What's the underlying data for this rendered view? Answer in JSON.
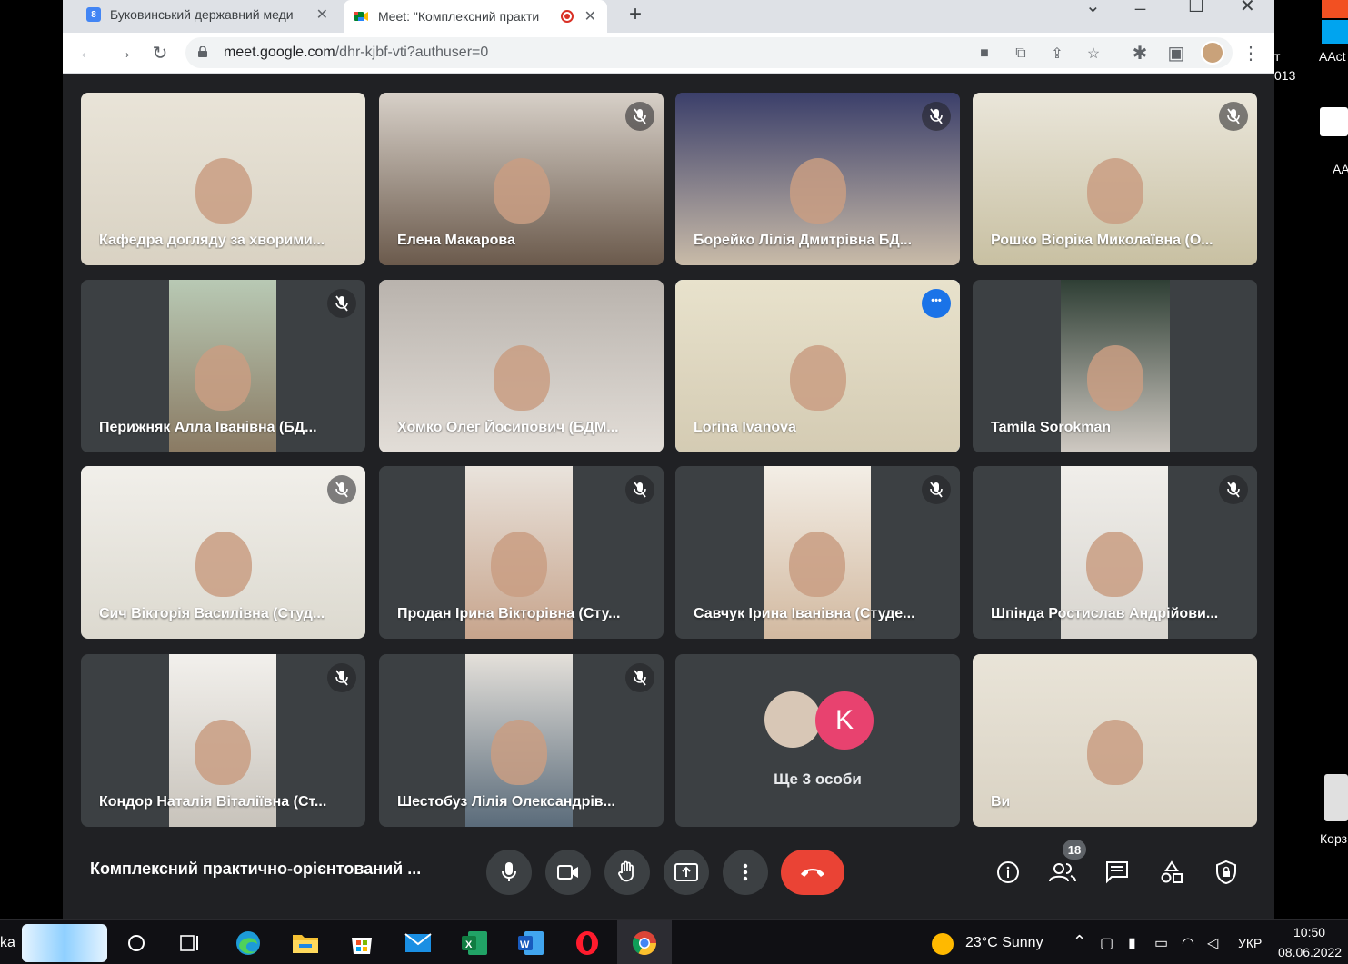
{
  "browser": {
    "tabs": [
      {
        "title": "Буковинський державний меди",
        "favicon": "calendar-icon"
      },
      {
        "title": "Meet: \"Комплексний практи",
        "favicon": "meet-icon",
        "recording": true
      }
    ],
    "url_host": "meet.google.com",
    "url_path": "/dhr-kjbf-vti?authuser=0"
  },
  "participants": [
    {
      "name": "Кафедра догляду за хворими...",
      "muted": false
    },
    {
      "name": "Елена Макарова",
      "muted": true
    },
    {
      "name": "Борейко Лілія Дмитрівна БД...",
      "muted": true
    },
    {
      "name": "Рошко Віоріка Миколаївна (О...",
      "muted": true
    },
    {
      "name": "Перижняк Алла Іванівна (БД...",
      "muted": true
    },
    {
      "name": "Хомко Олег Йосипович (БДМ...",
      "muted": false
    },
    {
      "name": "Lorina Ivanova",
      "muted": false,
      "speaking": true
    },
    {
      "name": "Tamila Sorokman",
      "muted": false
    },
    {
      "name": "Сич Вікторія Василівна (Студ...",
      "muted": true
    },
    {
      "name": "Продан Ірина Вікторівна (Сту...",
      "muted": true
    },
    {
      "name": "Савчук Ірина Іванівна (Студе...",
      "muted": true
    },
    {
      "name": "Шпінда Ростислав Андрійови...",
      "muted": true
    },
    {
      "name": "Кондор Наталія Віталіївна (Ст...",
      "muted": true
    },
    {
      "name": "Шестобуз Лілія Олександрів...",
      "muted": true
    },
    {
      "name": "Ви",
      "muted": false
    }
  ],
  "overflow": {
    "avatar_letter": "K",
    "label": "Ще 3 особи"
  },
  "meeting": {
    "title": "Комплексний практично-орієнтований ...",
    "participant_count": "18"
  },
  "desktop": {
    "right_texts": [
      "т",
      "013",
      "AAct",
      "AA",
      "Корз"
    ]
  },
  "taskbar": {
    "left_text": "ka",
    "weather": "23°C  Sunny",
    "lang": "УКР",
    "time": "10:50",
    "date": "08.06.2022"
  },
  "colors": {
    "accent": "#1a73e8",
    "hangup": "#ea4335",
    "tile": "#3c4043",
    "bg": "#202124"
  }
}
